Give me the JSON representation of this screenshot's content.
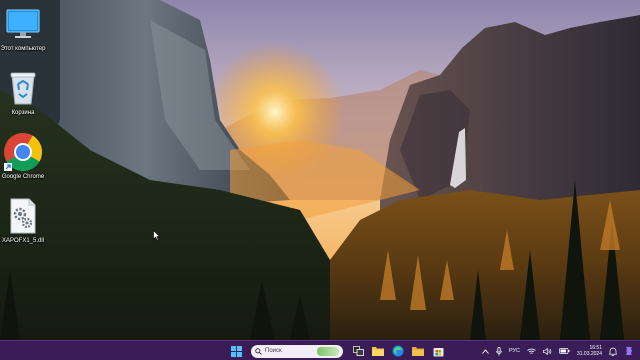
{
  "desktop": {
    "icons": [
      {
        "label": "Этот компьютер",
        "icon": "monitor-icon"
      },
      {
        "label": "Корзина",
        "icon": "recycle-bin-icon"
      },
      {
        "label": "Google Chrome",
        "icon": "chrome-icon"
      },
      {
        "label": "XAPOFX1_5.dll",
        "icon": "dll-file-icon"
      }
    ]
  },
  "taskbar": {
    "search_placeholder": "Поиск",
    "apps": [
      "start-icon",
      "search-icon",
      "task-view-icon",
      "file-explorer-icon",
      "edge-icon",
      "folder-icon",
      "store-icon"
    ],
    "tray": {
      "language": "РУС",
      "time": "16:51",
      "date": "31.03.2024"
    }
  },
  "colors": {
    "taskbar_bg": "#3a1d57",
    "sun": "#ffb640"
  }
}
